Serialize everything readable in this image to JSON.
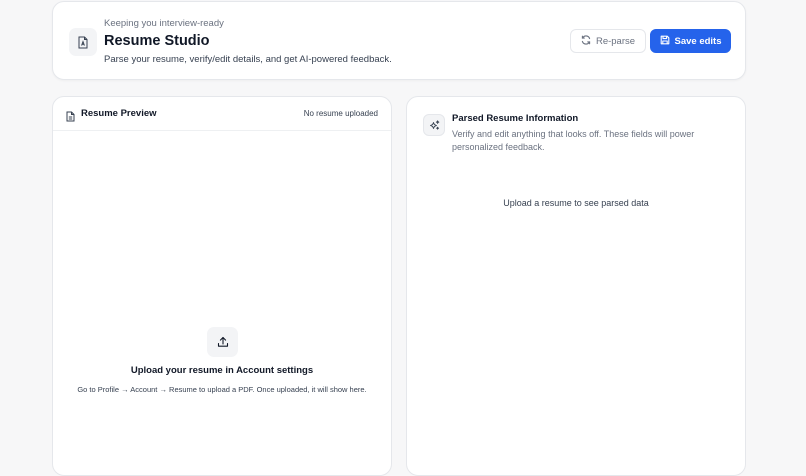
{
  "header": {
    "eyebrow": "Keeping you interview-ready",
    "title": "Resume Studio",
    "subtitle": "Parse your resume, verify/edit details, and get AI-powered feedback.",
    "icon": "resume-file-icon",
    "reparse_label": "Re-parse",
    "save_label": "Save edits",
    "accent_color": "#2563eb"
  },
  "preview": {
    "title": "Resume Preview",
    "status": "No resume uploaded",
    "empty_title": "Upload your resume in Account settings",
    "empty_hint": "Go to Profile → Account → Resume to upload a PDF. Once uploaded, it will show here.",
    "icon": "document-icon",
    "upload_icon": "upload-icon"
  },
  "parsed": {
    "title": "Parsed Resume Information",
    "description": "Verify and edit anything that looks off. These fields will power personalized feedback.",
    "empty": "Upload a resume to see parsed data",
    "icon": "sparkle-icon"
  }
}
